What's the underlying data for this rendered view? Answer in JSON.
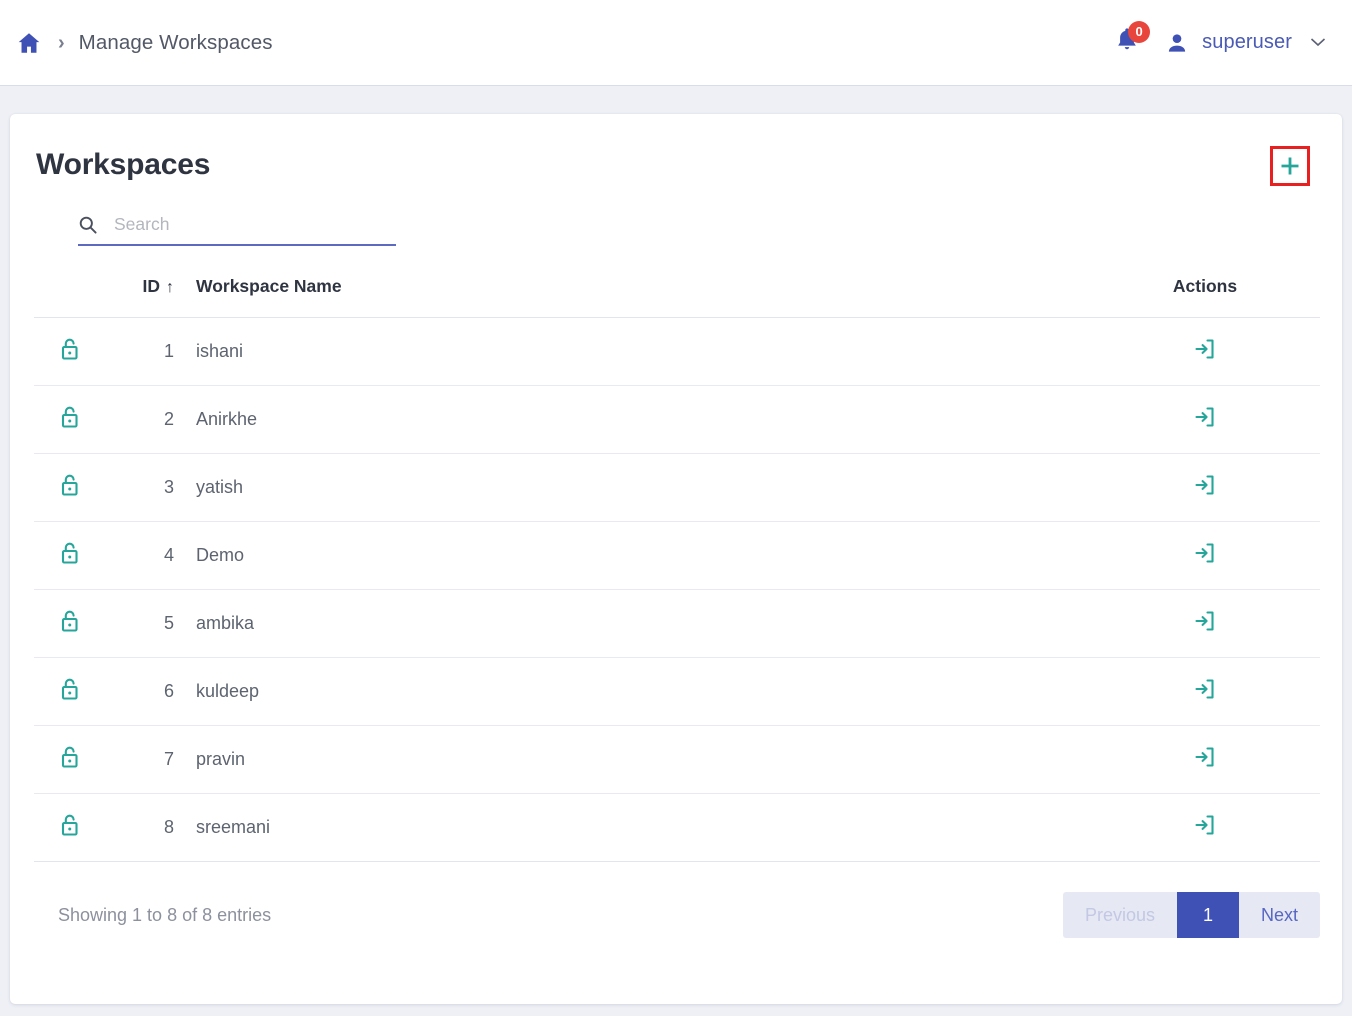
{
  "topbar": {
    "home_icon": "home-icon",
    "separator": "›",
    "breadcrumb_label": "Manage Workspaces",
    "notification_count": "0",
    "bell_icon": "bell-icon",
    "avatar_icon": "person-icon",
    "username": "superuser",
    "caret": "⌄",
    "badge_color": "#e8453c",
    "accent_color": "#3f51b5"
  },
  "card": {
    "title": "Workspaces",
    "add_button_label": "+",
    "add_button_highlight_color": "#e8201f",
    "teal_color": "#26a69a"
  },
  "search": {
    "placeholder": "Search",
    "value": "",
    "icon": "search-icon",
    "underline_color": "#5c6bc0"
  },
  "table": {
    "columns": {
      "lock": "",
      "id": "ID",
      "sort_indicator": "↑",
      "name": "Workspace Name",
      "actions": "Actions"
    },
    "rows": [
      {
        "lock_icon": "unlocked-padlock-icon",
        "id": "1",
        "name": "ishani",
        "action_icon": "enter-workspace-icon"
      },
      {
        "lock_icon": "unlocked-padlock-icon",
        "id": "2",
        "name": "Anirkhe",
        "action_icon": "enter-workspace-icon"
      },
      {
        "lock_icon": "unlocked-padlock-icon",
        "id": "3",
        "name": "yatish",
        "action_icon": "enter-workspace-icon"
      },
      {
        "lock_icon": "unlocked-padlock-icon",
        "id": "4",
        "name": "Demo",
        "action_icon": "enter-workspace-icon"
      },
      {
        "lock_icon": "unlocked-padlock-icon",
        "id": "5",
        "name": "ambika",
        "action_icon": "enter-workspace-icon"
      },
      {
        "lock_icon": "unlocked-padlock-icon",
        "id": "6",
        "name": "kuldeep",
        "action_icon": "enter-workspace-icon"
      },
      {
        "lock_icon": "unlocked-padlock-icon",
        "id": "7",
        "name": "pravin",
        "action_icon": "enter-workspace-icon"
      },
      {
        "lock_icon": "unlocked-padlock-icon",
        "id": "8",
        "name": "sreemani",
        "action_icon": "enter-workspace-icon"
      }
    ]
  },
  "footer": {
    "entries_text": "Showing 1 to 8 of 8 entries",
    "pagination": {
      "previous_label": "Previous",
      "current_page": "1",
      "next_label": "Next",
      "active_color": "#3f51b5",
      "track_color": "#e6e8f4"
    }
  }
}
